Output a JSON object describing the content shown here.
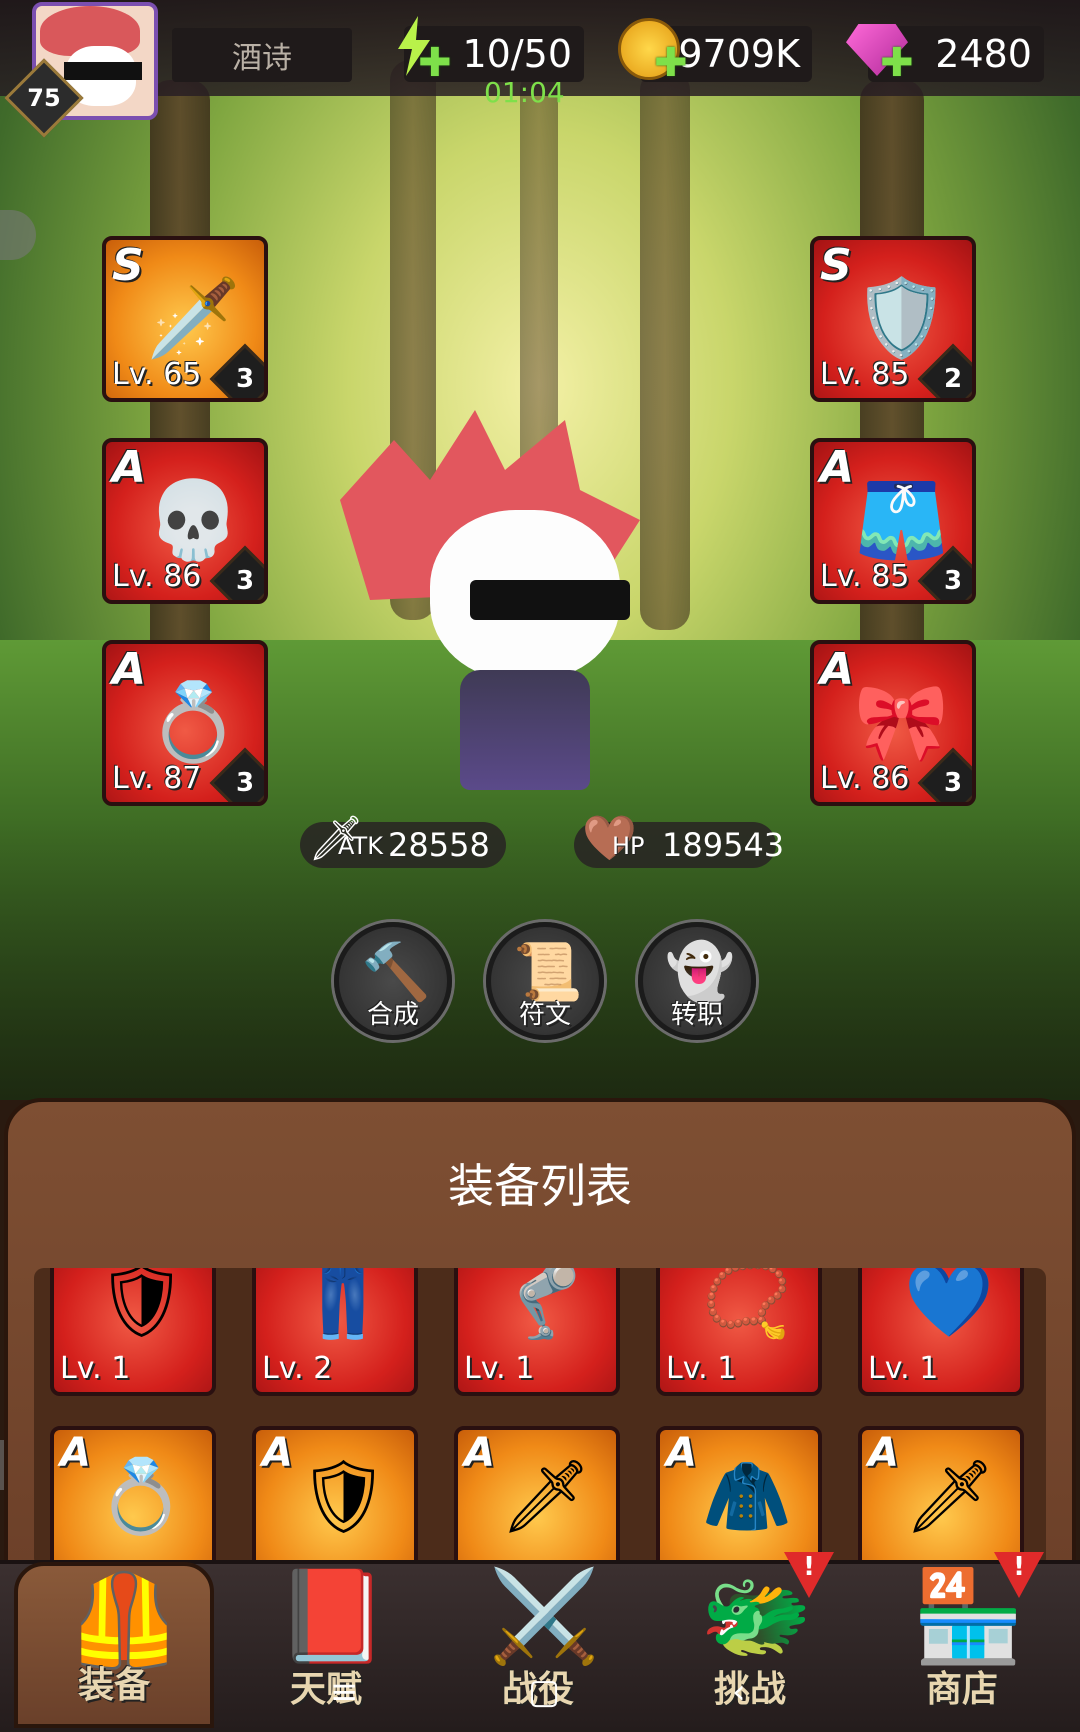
{
  "player": {
    "level": "75",
    "name": "酒诗"
  },
  "resources": {
    "energy": "10/50",
    "energy_timer": "01:04",
    "gold": "9709K",
    "gems": "2480"
  },
  "equipped": [
    {
      "slot": "weapon",
      "grade": "S",
      "level": "Lv. 65",
      "stars": "3",
      "icon": "sword-icon"
    },
    {
      "slot": "armor",
      "grade": "S",
      "level": "Lv. 85",
      "stars": "2",
      "icon": "golden-armor-icon"
    },
    {
      "slot": "cloak",
      "grade": "A",
      "level": "Lv. 86",
      "stars": "3",
      "icon": "skull-cloak-icon"
    },
    {
      "slot": "pants",
      "grade": "A",
      "level": "Lv. 85",
      "stars": "3",
      "icon": "red-pants-icon"
    },
    {
      "slot": "ring",
      "grade": "A",
      "level": "Lv. 87",
      "stars": "3",
      "icon": "ring-icon"
    },
    {
      "slot": "necklace",
      "grade": "A",
      "level": "Lv. 86",
      "stars": "3",
      "icon": "red-amulet-icon"
    }
  ],
  "stats": {
    "atk_label": "ATK",
    "atk": "28558",
    "hp_label": "HP",
    "hp": "189543"
  },
  "actions": {
    "craft": "合成",
    "rune": "符文",
    "job": "转职"
  },
  "panel": {
    "title": "装备列表"
  },
  "items_row1": [
    {
      "level": "Lv. 1",
      "icon": "silver-armor-icon"
    },
    {
      "level": "Lv. 2",
      "icon": "blue-pants-icon"
    },
    {
      "level": "Lv. 1",
      "icon": "steel-greaves-icon"
    },
    {
      "level": "Lv. 1",
      "icon": "gold-necklace-icon"
    },
    {
      "level": "Lv. 1",
      "icon": "heart-necklace-icon"
    }
  ],
  "items_row2": [
    {
      "grade": "A",
      "icon": "ring-icon"
    },
    {
      "grade": "A",
      "icon": "silver-armor-icon"
    },
    {
      "grade": "A",
      "icon": "sword-icon"
    },
    {
      "grade": "A",
      "icon": "purple-cloak-icon"
    },
    {
      "grade": "A",
      "icon": "sword-icon"
    }
  ],
  "tabs": [
    {
      "label": "装备",
      "icon": "armor-tab-icon"
    },
    {
      "label": "天赋",
      "icon": "book-tab-icon"
    },
    {
      "label": "战役",
      "icon": "crossed-swords-icon"
    },
    {
      "label": "挑战",
      "icon": "dragon-castle-icon"
    },
    {
      "label": "商店",
      "icon": "shop-icon"
    }
  ]
}
